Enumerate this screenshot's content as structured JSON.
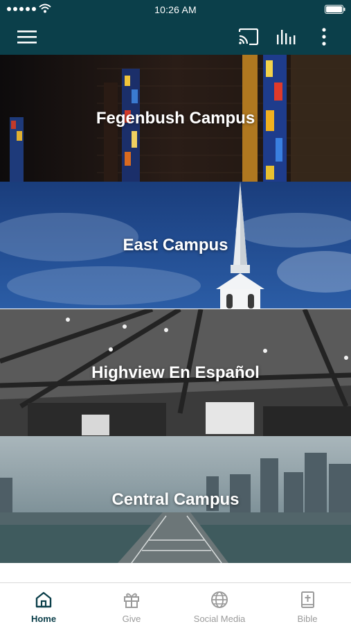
{
  "status_bar": {
    "time": "10:26 AM"
  },
  "app_bar": {
    "menu_icon": "hamburger-menu-icon",
    "cast_icon": "cast-icon",
    "live_icon": "audio-bars-icon",
    "more_icon": "more-vertical-icon"
  },
  "campuses": [
    {
      "label": "Fegenbush Campus",
      "image": "stained-glass-windows"
    },
    {
      "label": "East Campus",
      "image": "church-steeple-sky"
    },
    {
      "label": "Highview En Español",
      "image": "auditorium-ceiling-lights"
    },
    {
      "label": "Central Campus",
      "image": "city-skyline-bridge"
    }
  ],
  "bottom_nav": {
    "items": [
      {
        "label": "Home",
        "icon": "home-icon",
        "active": true
      },
      {
        "label": "Give",
        "icon": "gift-icon",
        "active": false
      },
      {
        "label": "Social Media",
        "icon": "globe-icon",
        "active": false
      },
      {
        "label": "Bible",
        "icon": "bible-icon",
        "active": false
      }
    ]
  },
  "colors": {
    "header_bg": "#0b3f4a",
    "active_nav": "#0b3f4a",
    "inactive_nav": "#9a9a9a"
  }
}
